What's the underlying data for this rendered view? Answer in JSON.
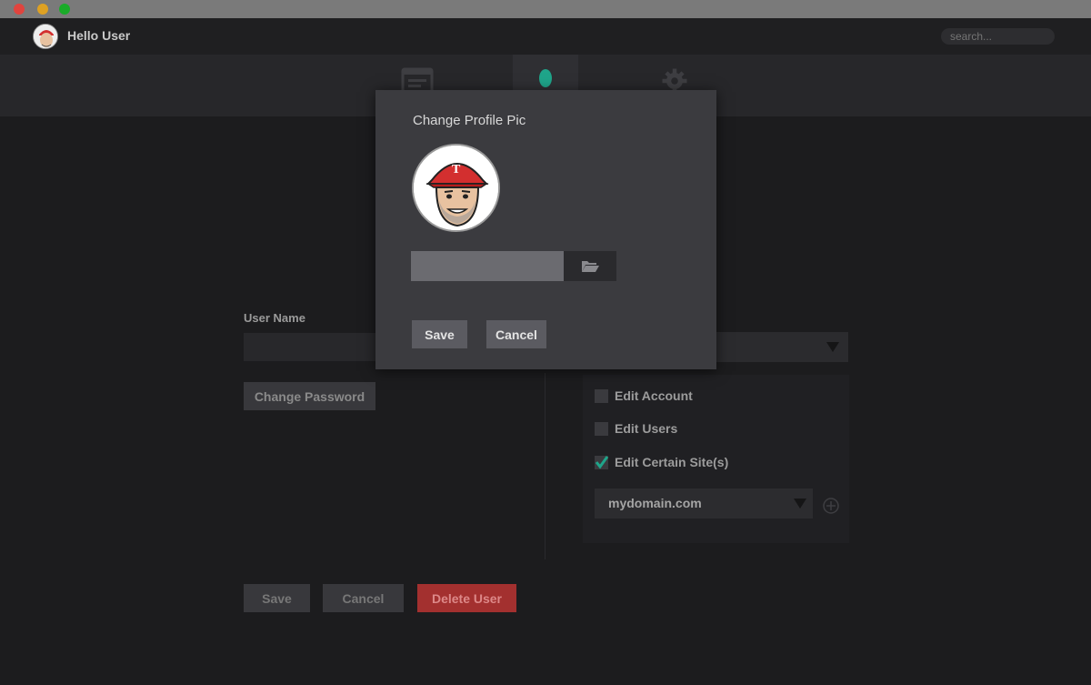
{
  "header": {
    "greeting": "Hello User",
    "search_placeholder": "search..."
  },
  "nav": {
    "tabs": [
      {
        "icon": "browser-window-icon",
        "active": false
      },
      {
        "icon": "user-icon",
        "active": true
      },
      {
        "icon": "gear-icon",
        "active": false
      }
    ],
    "accent": "#1fa58a"
  },
  "form": {
    "username_label": "User Name",
    "username_value": "",
    "change_password_label": "Change Password",
    "permissions": [
      {
        "label": "Edit Account",
        "checked": false
      },
      {
        "label": "Edit Users",
        "checked": false
      },
      {
        "label": "Edit Certain Site(s)",
        "checked": true
      }
    ],
    "site_select_value": "mydomain.com",
    "save_label": "Save",
    "cancel_label": "Cancel",
    "delete_label": "Delete User"
  },
  "modal": {
    "title": "Change Profile Pic",
    "file_value": "",
    "save_label": "Save",
    "cancel_label": "Cancel"
  },
  "colors": {
    "danger": "#a3302f",
    "check": "#1fa58a"
  }
}
